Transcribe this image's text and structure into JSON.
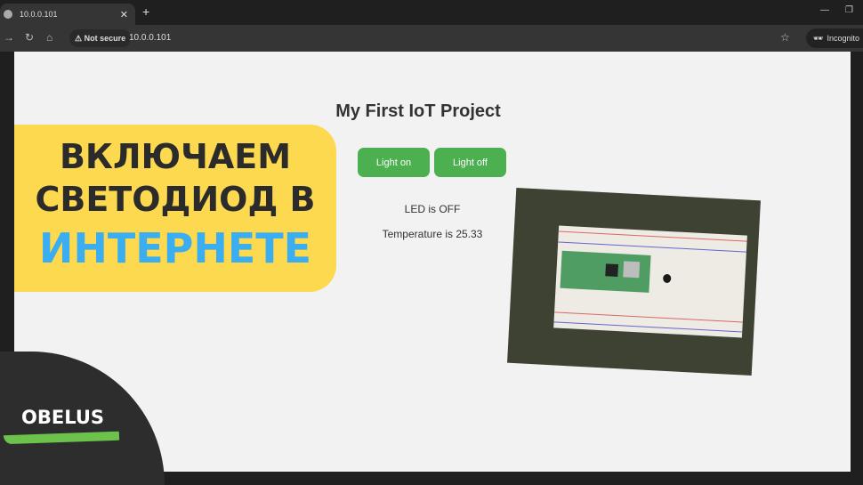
{
  "browser": {
    "tab_title": "10.0.0.101",
    "security_label": "Not secure",
    "url": "10.0.0.101",
    "profile_label": "Incognito"
  },
  "page": {
    "title": "My First IoT Project",
    "buttons": [
      {
        "label": "Light on"
      },
      {
        "label": "Light off"
      }
    ],
    "led_status": "LED is OFF",
    "temperature": "Temperature is 25.33",
    "button_color": "#4caf50"
  },
  "overlay": {
    "line1": "ВКЛЮЧАЕМ",
    "line2": "СВЕТОДИОД В",
    "line3": "ИНТЕРНЕТЕ",
    "banner_color": "#fdd94f",
    "accent_color": "#3aaef0",
    "logo": "OBELUS"
  }
}
